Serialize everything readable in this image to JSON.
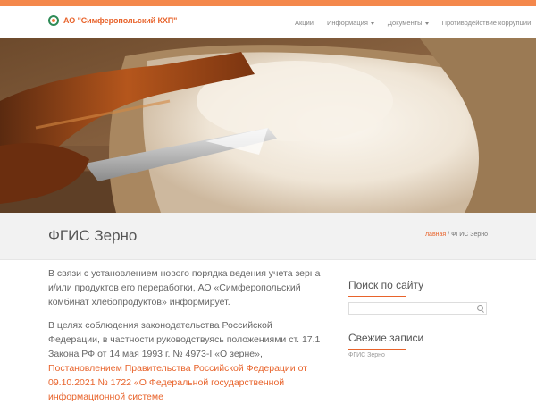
{
  "header": {
    "logo_text": "АО \"Симферопольский КХП\"",
    "menu": [
      {
        "label": "Акции",
        "has_caret": false
      },
      {
        "label": "Информация",
        "has_caret": true
      },
      {
        "label": "Документы",
        "has_caret": true
      },
      {
        "label": "Противодействие коррупции",
        "has_caret": false
      }
    ]
  },
  "page": {
    "title": "ФГИС Зерно",
    "breadcrumb": {
      "home": "Главная",
      "separator": " / ",
      "current": "ФГИС Зерно"
    }
  },
  "content": {
    "paragraph1": "В связи с установлением нового порядка ведения учета зерна и/или продуктов его переработки, АО «Симферопольский комбинат хлебопродуктов» информирует.",
    "paragraph2_text": "В целях соблюдения законодательства Российской Федерации, в частности руководствуясь положениями ст. 17.1 Закона РФ от 14 мая 1993 г. № 4973-I «О зерне», ",
    "paragraph2_link": "Постановлением Правительства Российской Федерации от 09.10.2021 № 1722 «О Федеральной государственной информационной системе"
  },
  "sidebar": {
    "search_title": "Поиск по сайту",
    "search_placeholder": "",
    "recent_title": "Свежие записи",
    "recent_first": "ФГИС Зерно"
  },
  "colors": {
    "accent": "#f4884c",
    "link": "#e8632b",
    "titlebar": "#f2f2f2"
  }
}
